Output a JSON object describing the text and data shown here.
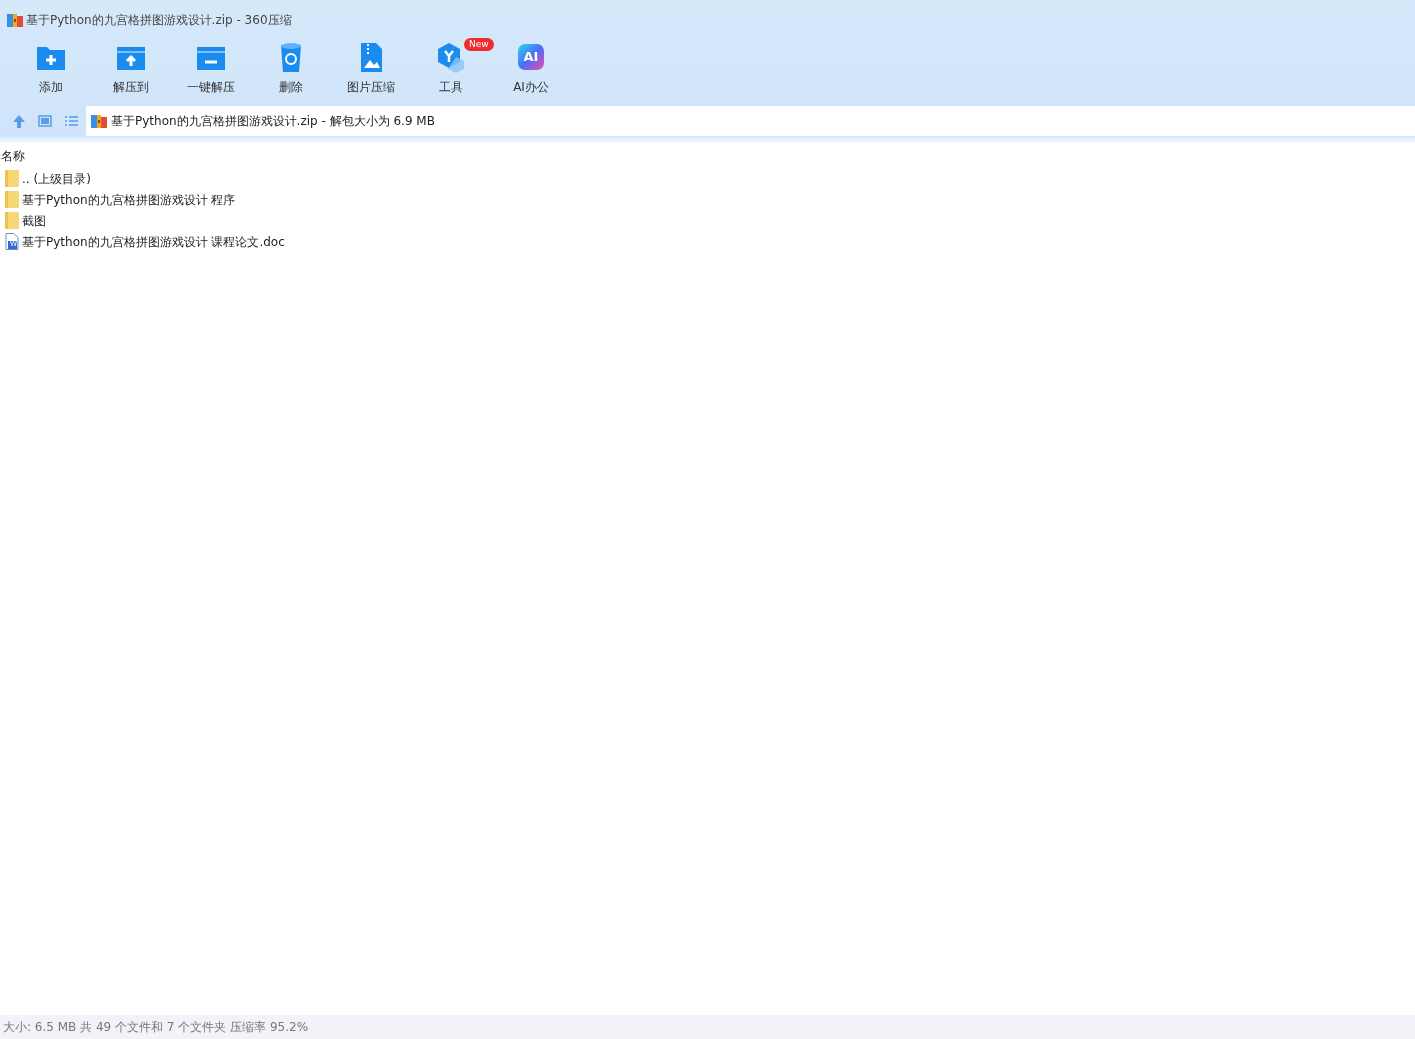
{
  "window": {
    "title": "基于Python的九宫格拼图游戏设计.zip - 360压缩"
  },
  "toolbar": [
    {
      "label": "添加",
      "kind": "add"
    },
    {
      "label": "解压到",
      "kind": "extract"
    },
    {
      "label": "一键解压",
      "kind": "onekey"
    },
    {
      "label": "删除",
      "kind": "delete"
    },
    {
      "label": "图片压缩",
      "kind": "image"
    },
    {
      "label": "工具",
      "kind": "tools",
      "badge": "New"
    },
    {
      "label": "AI办公",
      "kind": "ai",
      "icon_text": "AI"
    }
  ],
  "address": {
    "text": "基于Python的九宫格拼图游戏设计.zip - 解包大小为 6.9 MB"
  },
  "file_list": {
    "columns": [
      "名称"
    ],
    "rows": [
      {
        "name": ".. (上级目录)",
        "kind": "folder"
      },
      {
        "name": "基于Python的九宫格拼图游戏设计 程序",
        "kind": "folder"
      },
      {
        "name": "截图",
        "kind": "folder"
      },
      {
        "name": "基于Python的九宫格拼图游戏设计 课程论文.doc",
        "kind": "doc",
        "icon_text": "W"
      }
    ]
  },
  "status_bar": "大小: 6.5 MB 共 49 个文件和 7 个文件夹 压缩率 95.2%"
}
